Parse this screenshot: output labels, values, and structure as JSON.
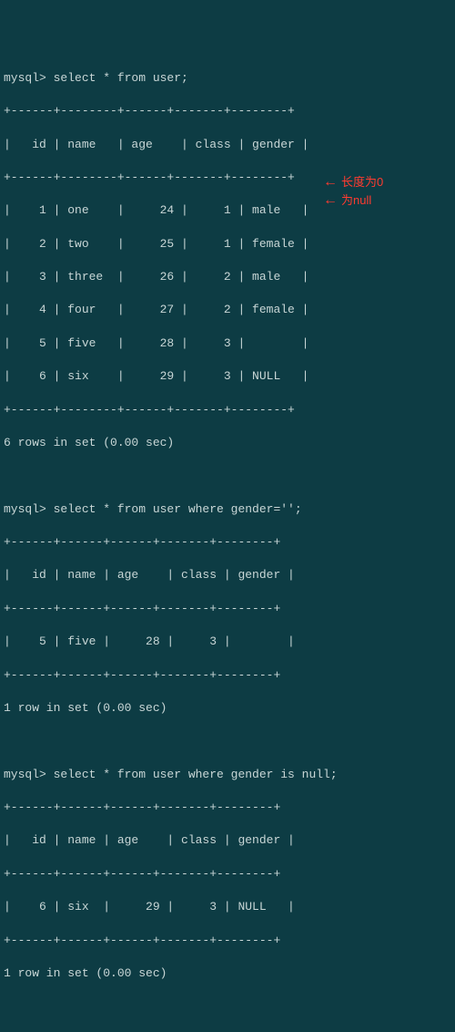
{
  "q1": {
    "prompt": "mysql> ",
    "sql": "select * from user;",
    "border": "+------+--------+------+-------+--------+",
    "header": "| id | name | age | class | gender |",
    "rows": [
      "| 1 | one | 24 | 1 | male |",
      "| 2 | two | 25 | 1 | female |",
      "| 3 | three | 26 | 2 | male |",
      "| 4 | four | 27 | 2 | female |",
      "| 5 | five | 28 | 3 | |",
      "| 6 | six | 29 | 3 | NULL |"
    ],
    "footer": "6 rows in set (0.00 sec)"
  },
  "q2": {
    "prompt": "mysql> ",
    "sql": "select * from user where gender='';",
    "border": "+------+------+------+-------+--------+",
    "header": "| id | name | age | class | gender |",
    "rows": [
      "| 5 | five | 28 | 3 | |"
    ],
    "footer": "1 row in set (0.00 sec)"
  },
  "q3": {
    "prompt": "mysql> ",
    "sql": "select * from user where gender is null;",
    "border": "+------+------+------+-------+--------+",
    "header": "| id | name | age | class | gender |",
    "rows": [
      "| 6 | six | 29 | 3 | NULL |"
    ],
    "footer": "1 row in set (0.00 sec)"
  },
  "ann": {
    "a1": "长度为0",
    "a2": "为null"
  },
  "chart_data": {
    "type": "table",
    "columns": [
      "id",
      "name",
      "age",
      "class",
      "gender"
    ],
    "rows": [
      {
        "id": 1,
        "name": "one",
        "age": 24,
        "class": 1,
        "gender": "male"
      },
      {
        "id": 2,
        "name": "two",
        "age": 25,
        "class": 1,
        "gender": "female"
      },
      {
        "id": 3,
        "name": "three",
        "age": 26,
        "class": 2,
        "gender": "male"
      },
      {
        "id": 4,
        "name": "four",
        "age": 27,
        "class": 2,
        "gender": "female"
      },
      {
        "id": 5,
        "name": "five",
        "age": 28,
        "class": 3,
        "gender": ""
      },
      {
        "id": 6,
        "name": "six",
        "age": 29,
        "class": 3,
        "gender": null
      }
    ]
  }
}
